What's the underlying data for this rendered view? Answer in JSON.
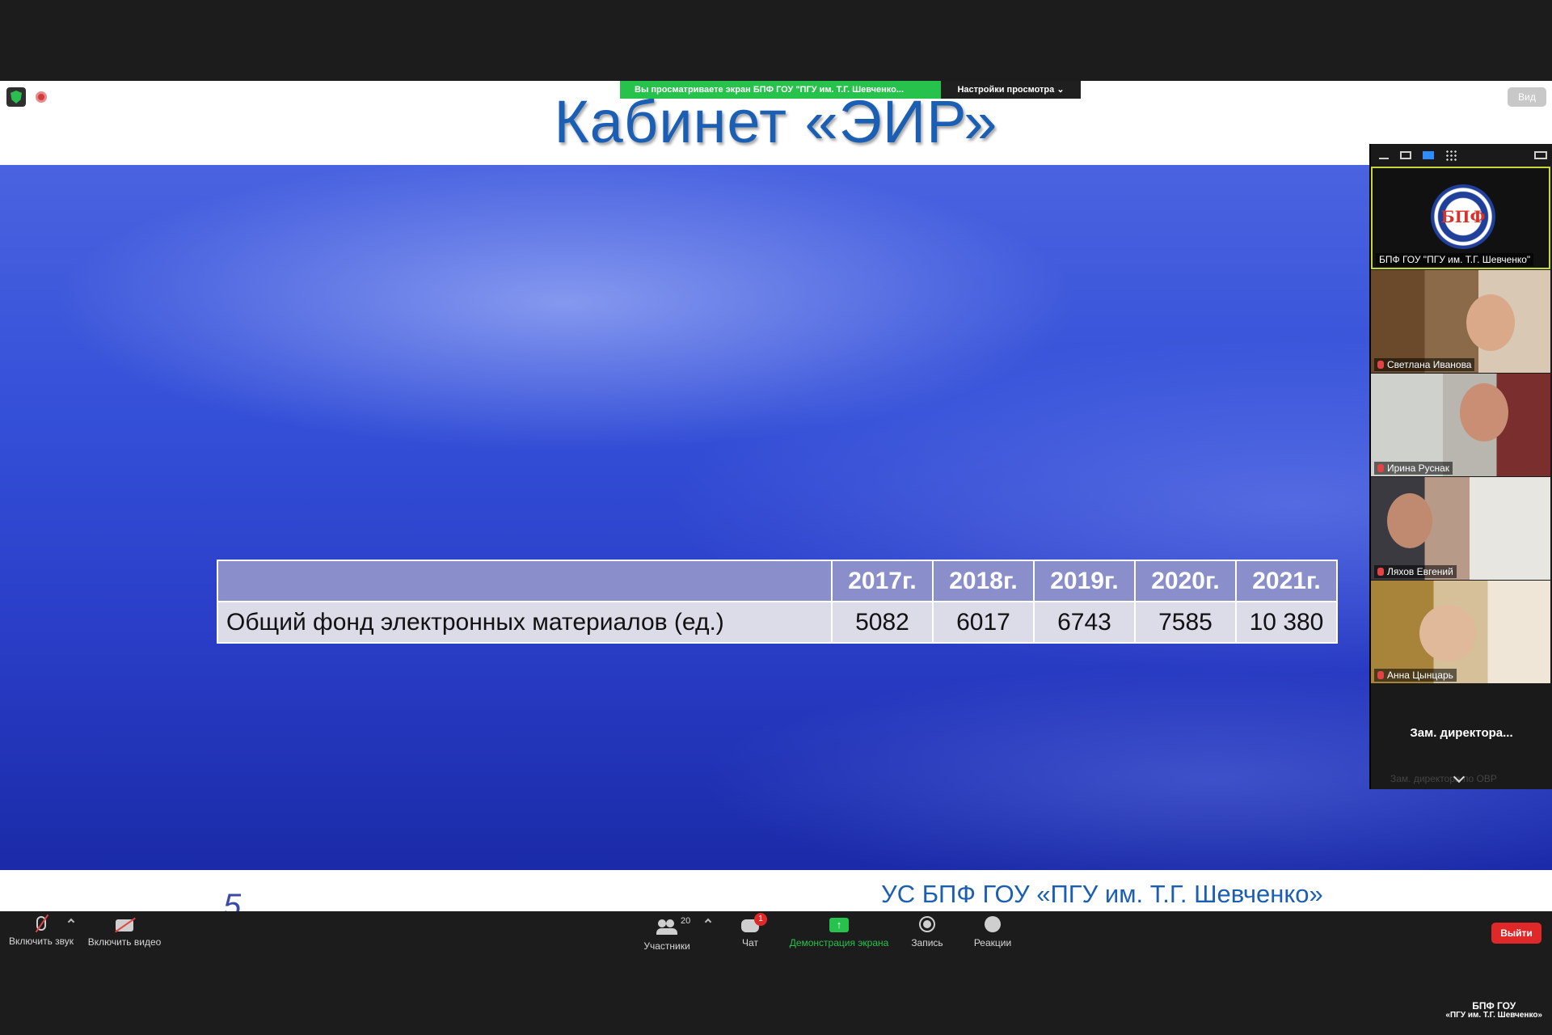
{
  "slide": {
    "title": "Кабинет «ЭИР»",
    "footer": "УС БПФ ГОУ «ПГУ им. Т.Г. Шевченко»",
    "page_number": "5",
    "table": {
      "headers": [
        "",
        "2017г.",
        "2018г.",
        "2019г.",
        "2020г.",
        "2021г."
      ],
      "row_label": "Общий фонд электронных материалов (ед.)",
      "values": [
        "5082",
        "6017",
        "6743",
        "7585",
        "10 380"
      ]
    }
  },
  "share_banner": {
    "message": "Вы просматриваете экран БПФ ГОУ \"ПГУ им. Т.Г. Шевченко...",
    "options_label": "Настройки просмотра ⌄"
  },
  "view_button": "Вид",
  "participants_panel": {
    "host_name": "БПФ ГОУ \"ПГУ им. Т.Г. Шевченко\"",
    "logo_text": "БПФ",
    "participants": [
      "Светлана Иванова",
      "Ирина Руснак",
      "Ляхов Евгений",
      "Анна Цынцарь"
    ],
    "next_participant": "Зам. директора...",
    "next_participant_sub": "Зам. директора по ОВР"
  },
  "toolbar": {
    "mute_label": "Включить звук",
    "video_label": "Включить видео",
    "participants_label": "Участники",
    "participants_count": "20",
    "chat_label": "Чат",
    "chat_badge": "1",
    "share_label": "Демонстрация экрана",
    "record_label": "Запись",
    "reactions_label": "Реакции",
    "leave_label": "Выйти"
  },
  "watermark": {
    "line1": "БПФ ГОУ",
    "line2": "«ПГУ им. Т.Г. Шевченко»"
  },
  "colors": {
    "accent_green": "#27c24c",
    "leave_red": "#e02828",
    "title_blue": "#1a5fb4"
  }
}
